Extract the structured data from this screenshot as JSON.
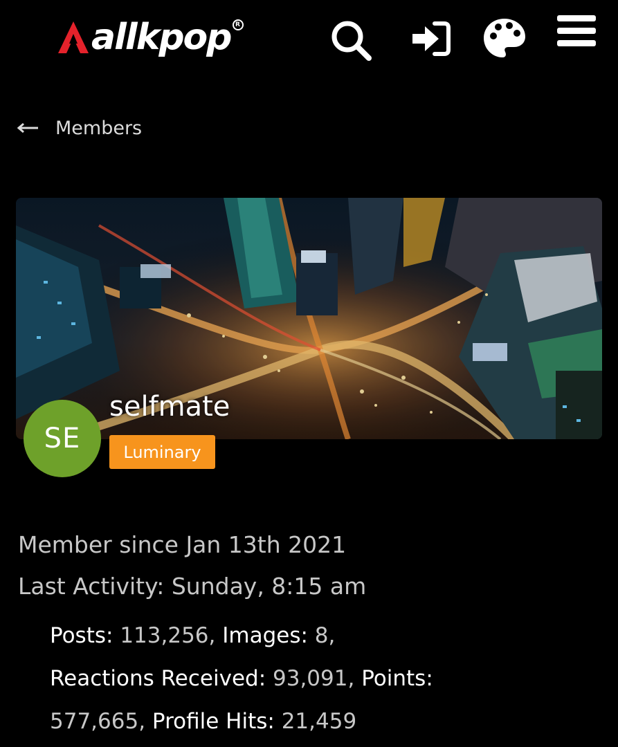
{
  "header": {
    "logo_text": "allkpop",
    "logo_mark_color": "#e4222b",
    "icons": [
      "search-icon",
      "sign-in-icon",
      "palette-icon",
      "menu-icon"
    ]
  },
  "nav": {
    "back_label": "Members"
  },
  "profile": {
    "avatar_initials": "SE",
    "avatar_color": "#6ea12a",
    "username": "selfmate",
    "role": "Luminary",
    "role_color": "#f7941d",
    "member_since": "Member since Jan 13th 2021",
    "last_activity": "Last Activity: Sunday, 8:15 am"
  },
  "stats": {
    "posts_label": "Posts:",
    "posts_value": "113,256",
    "images_label": "Images:",
    "images_value": "8",
    "reactions_label": "Reactions Received:",
    "reactions_value": "93,091",
    "points_label": "Points:",
    "points_value": "577,665",
    "hits_label": "Profile Hits:",
    "hits_value": "21,459"
  }
}
